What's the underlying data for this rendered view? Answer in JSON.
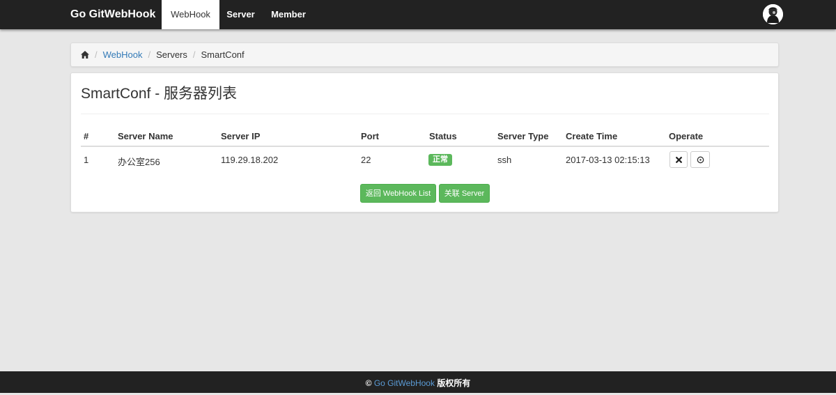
{
  "navbar": {
    "brand": "Go GitWebHook",
    "items": [
      {
        "label": "WebHook",
        "active": true
      },
      {
        "label": "Server",
        "active": false
      },
      {
        "label": "Member",
        "active": false
      }
    ],
    "avatar_icon": "user-avatar"
  },
  "breadcrumb": {
    "home_icon": "home-icon",
    "items": [
      "WebHook",
      "Servers",
      "SmartConf"
    ]
  },
  "page": {
    "title": "SmartConf - 服务器列表"
  },
  "table": {
    "headers": [
      "#",
      "Server Name",
      "Server IP",
      "Port",
      "Status",
      "Server Type",
      "Create Time",
      "Operate"
    ],
    "rows": [
      {
        "index": "1",
        "server_name": "办公室256",
        "server_ip": "119.29.18.202",
        "port": "22",
        "status": "正常",
        "server_type": "ssh",
        "create_time": "2017-03-13 02:15:13",
        "operate_icons": [
          "close-icon",
          "circle-icon"
        ]
      }
    ]
  },
  "actions": {
    "back_label": "返回 WebHook List",
    "link_label": "关联 Server"
  },
  "footer": {
    "copyright_symbol": "©",
    "link": "Go GitWebHook",
    "suffix": "版权所有"
  },
  "colors": {
    "navbar_bg": "#222222",
    "link": "#337ab7",
    "success": "#5cb85c",
    "background": "#e7e7e7"
  }
}
